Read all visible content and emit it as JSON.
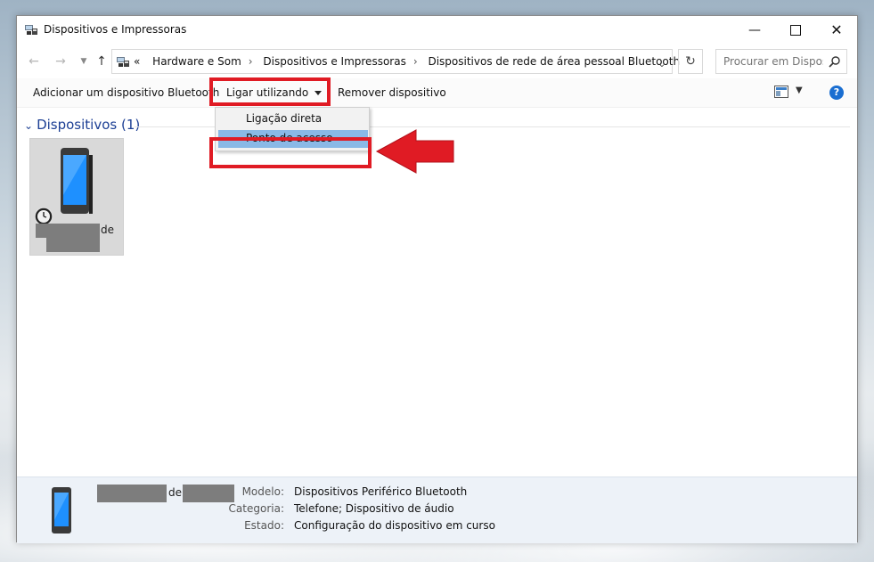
{
  "window": {
    "title": "Dispositivos e Impressoras"
  },
  "address": {
    "overflow": "«",
    "crumbs": [
      "Hardware e Som",
      "Dispositivos e Impressoras",
      "Dispositivos de rede de área pessoal Bluetooth"
    ]
  },
  "search": {
    "placeholder": "Procurar em Dispos..."
  },
  "toolbar": {
    "add_bluetooth": "Adicionar um dispositivo Bluetooth",
    "connect_using": "Ligar utilizando",
    "remove_device": "Remover dispositivo"
  },
  "dropdown": {
    "items": [
      "Ligação direta",
      "Ponto de acesso"
    ],
    "highlighted": "Ponto de acesso"
  },
  "group": {
    "title": "Dispositivos (1)"
  },
  "device": {
    "name_suffix": "de"
  },
  "details": {
    "name_mid": "de",
    "model_label": "Modelo:",
    "model_value": "Dispositivos Periférico Bluetooth",
    "category_label": "Categoria:",
    "category_value": "Telefone; Dispositivo de áudio",
    "status_label": "Estado:",
    "status_value": "Configuração do dispositivo em curso"
  },
  "colors": {
    "highlight": "#e01b24",
    "link": "#1c3f94",
    "menu_hover": "#8ab9e6"
  }
}
